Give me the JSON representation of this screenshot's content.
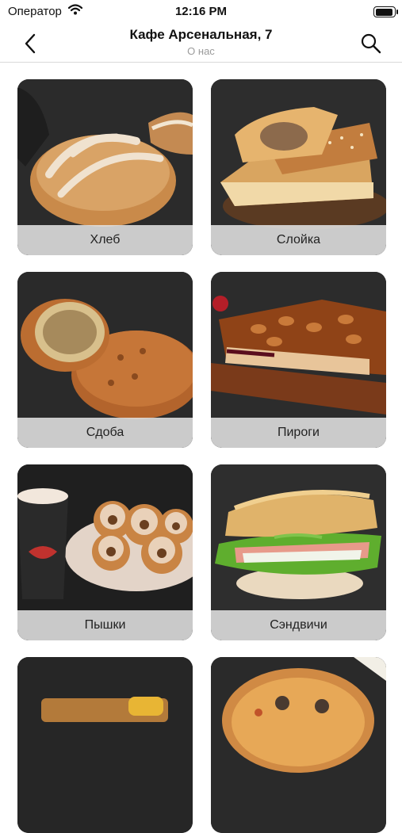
{
  "status_bar": {
    "carrier": "Оператор",
    "time": "12:16 PM",
    "battery_level": 0.9
  },
  "nav": {
    "title": "Кафе Арсенальная, 7",
    "subtitle": "О нас",
    "back_icon": "chevron-left-icon",
    "search_icon": "search-icon"
  },
  "categories": [
    {
      "label": "Хлеб",
      "image": "bread-photo"
    },
    {
      "label": "Слойка",
      "image": "puff-pastry-photo"
    },
    {
      "label": "Сдоба",
      "image": "buns-photo"
    },
    {
      "label": "Пироги",
      "image": "pie-photo"
    },
    {
      "label": "Пышки",
      "image": "donuts-photo"
    },
    {
      "label": "Сэндвичи",
      "image": "sandwich-photo"
    },
    {
      "label": "",
      "image": "pastry-box-photo"
    },
    {
      "label": "",
      "image": "pizza-photo"
    }
  ]
}
